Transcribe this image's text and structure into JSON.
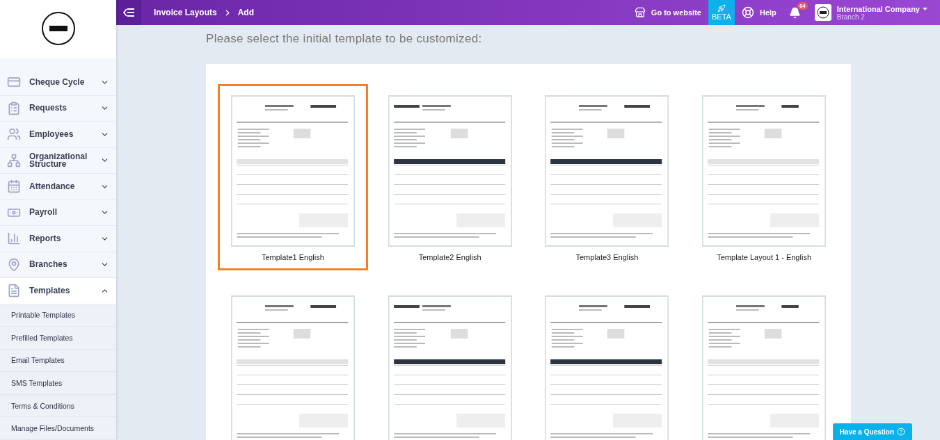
{
  "header": {
    "breadcrumb": [
      "Invoice Layouts",
      "Add"
    ],
    "go_to_website": "Go to website",
    "beta": "BETA",
    "help": "Help",
    "notifications": "64",
    "company": "International Company",
    "branch": "Branch 2"
  },
  "sidebar": {
    "items": [
      {
        "label": "Cheque Cycle",
        "expanded": false
      },
      {
        "label": "Requests",
        "expanded": false
      },
      {
        "label": "Employees",
        "expanded": false
      },
      {
        "label": "Organizational Structure",
        "expanded": false
      },
      {
        "label": "Attendance",
        "expanded": false
      },
      {
        "label": "Payroll",
        "expanded": false
      },
      {
        "label": "Reports",
        "expanded": false
      },
      {
        "label": "Branches",
        "expanded": false
      },
      {
        "label": "Templates",
        "expanded": true,
        "children": [
          "Printable Templates",
          "Prefilled Templates",
          "Email Templates",
          "SMS Templates",
          "Terms & Conditions",
          "Manage Files/Documents"
        ]
      }
    ]
  },
  "heading": "Please select the initial template to be customized:",
  "templates": [
    {
      "label": "Template1 English",
      "selected": true
    },
    {
      "label": "Template2 English",
      "selected": false
    },
    {
      "label": "Template3 English",
      "selected": false
    },
    {
      "label": "Template Layout 1 - English",
      "selected": false
    },
    {
      "selected": false
    },
    {
      "selected": false
    },
    {
      "selected": false
    },
    {
      "selected": false
    }
  ],
  "help_button": "Have a Question"
}
